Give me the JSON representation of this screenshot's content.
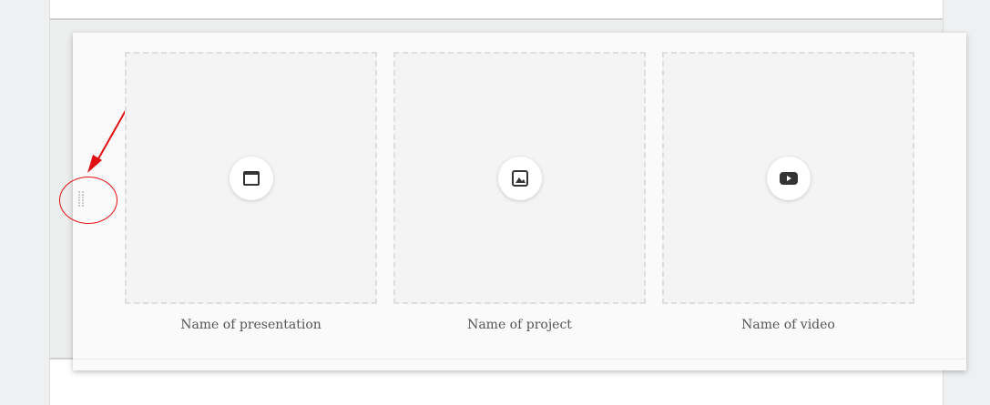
{
  "colors": {
    "page_background": "#eef0f2",
    "card_background": "#fafafa",
    "tile_background": "#f4f4f4",
    "tile_border": "#dedede",
    "icon_color": "#333333",
    "caption_color": "#555555",
    "annotation_red": "#e01010"
  },
  "section": {
    "items": [
      {
        "icon": "presentation-icon",
        "caption": "Name of presentation"
      },
      {
        "icon": "image-icon",
        "caption": "Name of project"
      },
      {
        "icon": "youtube-video-icon",
        "caption": "Name of video"
      }
    ],
    "drag_handle_icon": "drag-dots-icon"
  }
}
